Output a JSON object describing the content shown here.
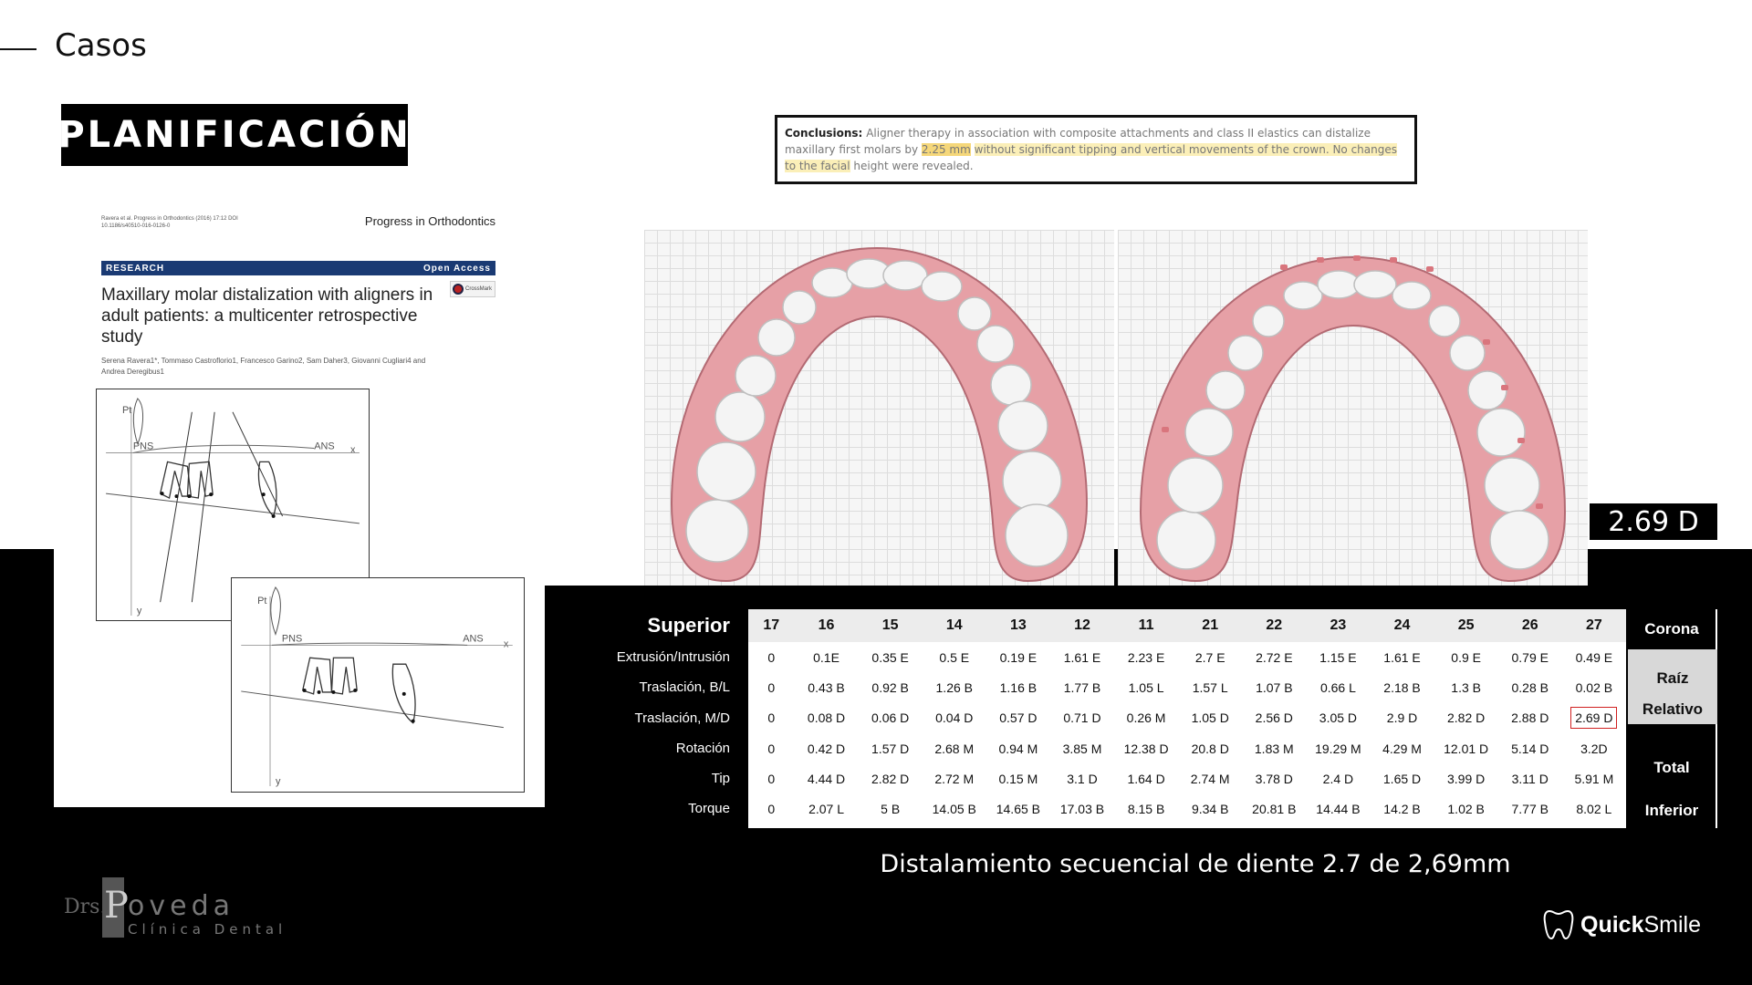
{
  "header": {
    "title": "Casos",
    "section_badge": "PLANIFICACIÓN"
  },
  "paper": {
    "citation": "Ravera et al. Progress in Orthodontics (2016) 17:12 DOI 10.1186/s40510-016-0126-0",
    "journal": "Progress in Orthodontics",
    "bar_left": "RESEARCH",
    "bar_right": "Open Access",
    "title": "Maxillary molar distalization with aligners in adult patients: a multicenter retrospective study",
    "crossmark": "CrossMark",
    "authors": "Serena Ravera1*, Tommaso Castroflorio1, Francesco Garino2, Sam Daher3, Giovanni Cugliari4 and Andrea Deregibus1",
    "figure_labels": {
      "pt": "Pt",
      "pns": "PNS",
      "ans": "ANS",
      "x": "x",
      "y": "y"
    }
  },
  "conclusions": {
    "label": "Conclusions:",
    "text_before": "Aligner therapy in association with composite attachments and class II elastics can distalize maxillary first molars by",
    "highlight_value": "2.25 mm",
    "highlight_text": "without significant tipping and vertical movements of the crown. No changes to the facial",
    "text_after": "height were revealed."
  },
  "value_badge": "2.69 D",
  "table": {
    "header_label": "Superior",
    "teeth": [
      "17",
      "16",
      "15",
      "14",
      "13",
      "12",
      "11",
      "21",
      "22",
      "23",
      "24",
      "25",
      "26",
      "27"
    ],
    "rows": [
      {
        "label": "Extrusión/Intrusión",
        "values": [
          "0",
          "0.1E",
          "0.35 E",
          "0.5 E",
          "0.19 E",
          "1.61 E",
          "2.23 E",
          "2.7 E",
          "2.72 E",
          "1.15 E",
          "1.61 E",
          "0.9 E",
          "0.79 E",
          "0.49 E"
        ]
      },
      {
        "label": "Traslación, B/L",
        "values": [
          "0",
          "0.43 B",
          "0.92 B",
          "1.26 B",
          "1.16 B",
          "1.77 B",
          "1.05 L",
          "1.57 L",
          "1.07 B",
          "0.66 L",
          "2.18 B",
          "1.3 B",
          "0.28 B",
          "0.02 B"
        ]
      },
      {
        "label": "Traslación, M/D",
        "values": [
          "0",
          "0.08 D",
          "0.06 D",
          "0.04 D",
          "0.57 D",
          "0.71 D",
          "0.26 M",
          "1.05 D",
          "2.56 D",
          "3.05 D",
          "2.9 D",
          "2.82 D",
          "2.88 D",
          "2.69 D"
        ]
      },
      {
        "label": "Rotación",
        "values": [
          "0",
          "0.42 D",
          "1.57 D",
          "2.68 M",
          "0.94 M",
          "3.85 M",
          "12.38 D",
          "20.8 D",
          "1.83 M",
          "19.29 M",
          "4.29 M",
          "12.01 D",
          "5.14 D",
          "3.2D"
        ]
      },
      {
        "label": "Tip",
        "values": [
          "0",
          "4.44 D",
          "2.82 D",
          "2.72 M",
          "0.15 M",
          "3.1 D",
          "1.64 D",
          "2.74 M",
          "3.78 D",
          "2.4 D",
          "1.65 D",
          "3.99 D",
          "3.11 D",
          "5.91 M"
        ]
      },
      {
        "label": "Torque",
        "values": [
          "0",
          "2.07 L",
          "5 B",
          "14.05 B",
          "14.65 B",
          "17.03 B",
          "8.15 B",
          "9.34 B",
          "20.81 B",
          "14.44 B",
          "14.2 B",
          "1.02 B",
          "7.77 B",
          "8.02 L"
        ]
      }
    ],
    "legend": {
      "corona": "Corona",
      "raiz": "Raíz",
      "relativo": "Relativo",
      "total": "Total",
      "inferior": "Inferior"
    },
    "highlight_color": "#d02020"
  },
  "caption": "Distalamiento secuencial de diente 2.7 de 2,69mm",
  "logos": {
    "clinic": {
      "drs": "Drs.",
      "p": "P",
      "rest": "oveda",
      "sub": "Clínica Dental"
    },
    "brand": {
      "quick": "Quick",
      "smile": "Smile"
    }
  }
}
